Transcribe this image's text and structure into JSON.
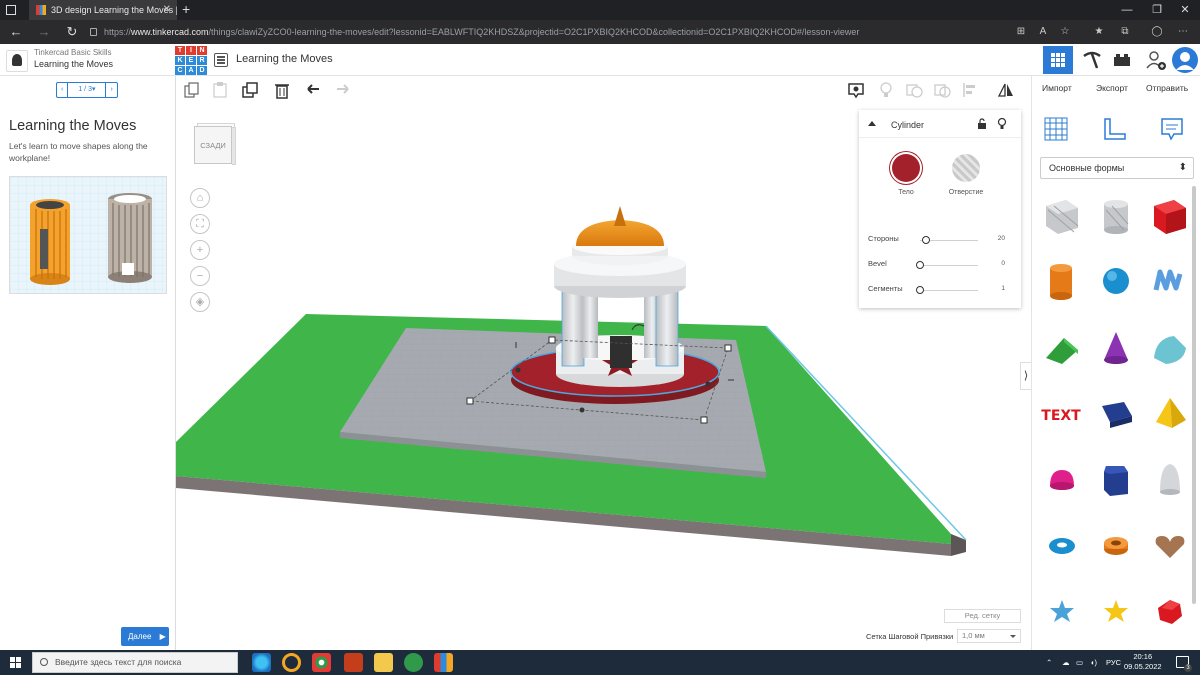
{
  "browser": {
    "tab_title": "3D design Learning the Moves |",
    "url_prefix": "https://",
    "url_host": "www.tinkercad.com",
    "url_path": "/things/clawiZyZCO0-learning-the-moves/edit?lessonid=EABLWFTIQ2KHDSZ&projectid=O2C1PXBIQ2KHCOD&collectionid=O2C1PXBIQ2KHCOD#/lesson-viewer"
  },
  "header": {
    "course_title": "Tinkercad Basic Skills",
    "course_subtitle": "Learning the Moves",
    "logo_letters": [
      "T",
      "I",
      "N",
      "K",
      "E",
      "R",
      "C",
      "A",
      "D"
    ],
    "design_title": "Learning the Moves"
  },
  "lesson": {
    "pager": "1 / 3▾",
    "title": "Learning the Moves",
    "text": "Let's learn to move shapes along the workplane!",
    "next_button": "Далее"
  },
  "viewcube": {
    "face_label": "СЗАДИ"
  },
  "right_top": {
    "import": "Импорт",
    "export": "Экспорт",
    "send": "Отправить"
  },
  "inspector": {
    "shape_name": "Cylinder",
    "solid_label": "Тело",
    "hole_label": "Отверстие",
    "props": [
      {
        "label": "Стороны",
        "value": "20",
        "level": 0.1
      },
      {
        "label": "Bevel",
        "value": "0",
        "level": 0
      },
      {
        "label": "Сегменты",
        "value": "1",
        "level": 0
      }
    ]
  },
  "workplane": {
    "edit_grid": "Ред. сетку",
    "snap_label": "Сетка Шаговой Привязки",
    "snap_value": "1,0 мм"
  },
  "shapes": {
    "category": "Основные формы",
    "items": [
      "box-hole-icon",
      "cylinder-hole-icon",
      "box-icon",
      "cylinder-icon",
      "sphere-icon",
      "scribble-icon",
      "roof-icon",
      "cone-icon",
      "round-roof-icon",
      "text-icon",
      "wedge-icon",
      "pyramid-icon",
      "half-sphere-icon",
      "polygon-icon",
      "paraboloid-icon",
      "torus-icon",
      "tube-icon",
      "heart-icon",
      "star-icon",
      "star-yellow-icon",
      "gem-icon"
    ],
    "text_shape_label": "TEXT"
  },
  "taskbar": {
    "search_placeholder": "Введите здесь текст для поиска",
    "lang": "РУС",
    "time": "20:16",
    "date": "09.05.2022",
    "notif_count": "3"
  },
  "colors": {
    "accent": "#2b7bd6",
    "solid": "#a3212a",
    "green": "#3fb54a",
    "orange": "#e47b18"
  }
}
